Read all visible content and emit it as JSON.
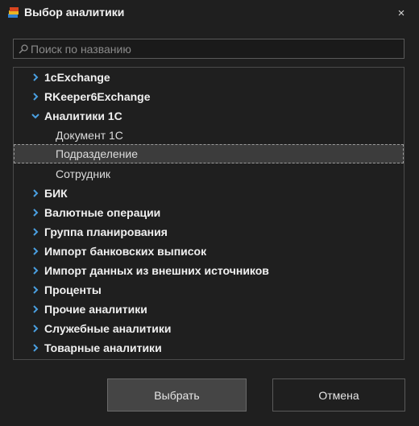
{
  "window": {
    "title": "Выбор аналитики",
    "close_label": "×"
  },
  "search": {
    "placeholder": "Поиск по названию",
    "value": ""
  },
  "tree": {
    "items": [
      {
        "label": "1cExchange",
        "level": 0,
        "expanded": false,
        "selected": false
      },
      {
        "label": "RKeeper6Exchange",
        "level": 0,
        "expanded": false,
        "selected": false
      },
      {
        "label": "Аналитики 1С",
        "level": 0,
        "expanded": true,
        "selected": false
      },
      {
        "label": "Документ 1С",
        "level": 1,
        "selected": false
      },
      {
        "label": "Подразделение",
        "level": 1,
        "selected": true
      },
      {
        "label": "Сотрудник",
        "level": 1,
        "selected": false
      },
      {
        "label": "БИК",
        "level": 0,
        "expanded": false,
        "selected": false
      },
      {
        "label": "Валютные операции",
        "level": 0,
        "expanded": false,
        "selected": false
      },
      {
        "label": "Группа планирования",
        "level": 0,
        "expanded": false,
        "selected": false
      },
      {
        "label": "Импорт банковских выписок",
        "level": 0,
        "expanded": false,
        "selected": false
      },
      {
        "label": "Импорт данных из внешних источников",
        "level": 0,
        "expanded": false,
        "selected": false
      },
      {
        "label": "Проценты",
        "level": 0,
        "expanded": false,
        "selected": false
      },
      {
        "label": "Прочие аналитики",
        "level": 0,
        "expanded": false,
        "selected": false
      },
      {
        "label": "Служебные аналитики",
        "level": 0,
        "expanded": false,
        "selected": false
      },
      {
        "label": "Товарные аналитики",
        "level": 0,
        "expanded": false,
        "selected": false
      }
    ]
  },
  "buttons": {
    "select_label": "Выбрать",
    "cancel_label": "Отмена"
  },
  "colors": {
    "background": "#1f1f1f",
    "chevron": "#4a9fe0",
    "selection": "#3c3c3c"
  },
  "icons": {
    "app": "app-icon",
    "close": "close-icon",
    "search": "search-icon",
    "collapsed": "chevron-right-icon",
    "expanded": "chevron-down-icon"
  }
}
